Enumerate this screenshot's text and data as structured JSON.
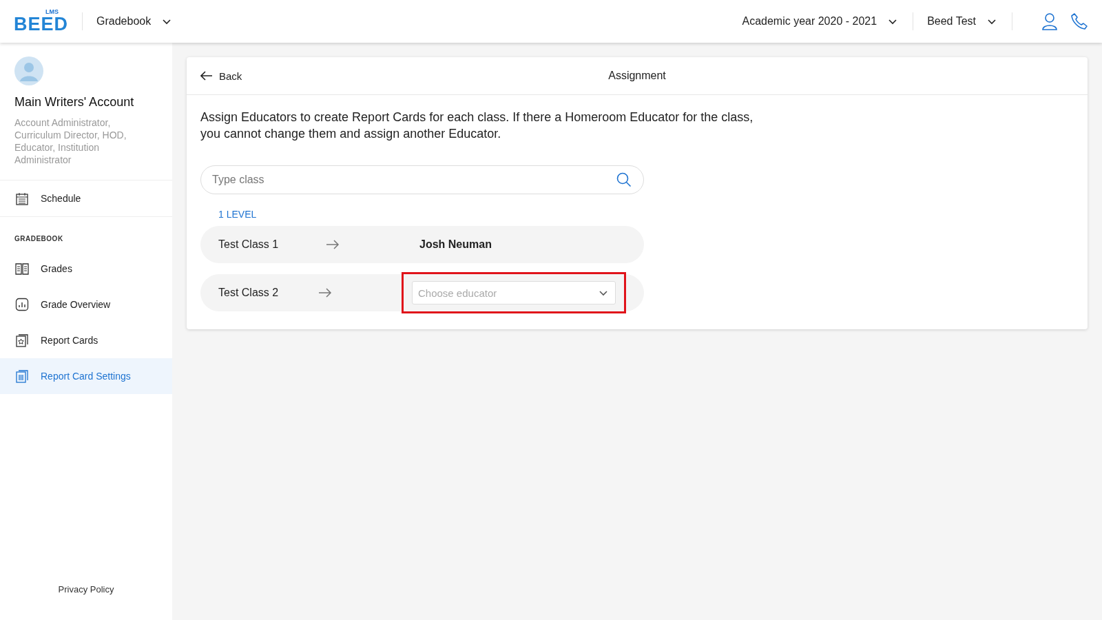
{
  "header": {
    "logo": {
      "mark": "BEED",
      "sub": "LMS"
    },
    "module": "Gradebook",
    "academic_year": "Academic year 2020 - 2021",
    "institution": "Beed Test"
  },
  "sidebar": {
    "user": {
      "name": "Main Writers' Account",
      "roles": "Account Administrator, Curriculum Director, HOD, Educator, Institution Administrator"
    },
    "items": [
      {
        "label": "Schedule",
        "kind": "calendar",
        "selected": false
      }
    ],
    "section": "GRADEBOOK",
    "section_items": [
      {
        "label": "Grades",
        "kind": "book",
        "selected": false
      },
      {
        "label": "Grade Overview",
        "kind": "chart",
        "selected": false
      },
      {
        "label": "Report Cards",
        "kind": "star",
        "selected": false
      },
      {
        "label": "Report Card Settings",
        "kind": "settings",
        "selected": true
      }
    ],
    "footer": "Privacy Policy"
  },
  "card": {
    "back": "Back",
    "title": "Assignment",
    "description": "Assign Educators to create Report Cards for each class. If there a Homeroom Educator for the class, you cannot change them and assign another Educator.",
    "search": {
      "placeholder": "Type class"
    },
    "level": "1 LEVEL",
    "rows": [
      {
        "class": "Test Class 1",
        "kind": "assigned",
        "educator": "Josh Neuman",
        "highlighted": false
      },
      {
        "class": "Test Class 2",
        "kind": "select",
        "placeholder": "Choose educator",
        "highlighted": true
      }
    ]
  }
}
